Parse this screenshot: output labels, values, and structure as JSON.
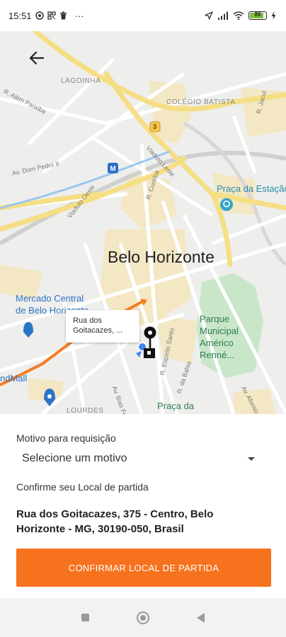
{
  "status_bar": {
    "time": "15:51",
    "more": "···",
    "battery_level": "86",
    "battery_color": "#7bc043"
  },
  "map": {
    "labels": {
      "lagoinha": "LAGOINHA",
      "colegio_batista": "COLÉGIO BATISTA",
      "alem_paraiba": "R. Além Paraíba",
      "jacui": "R. Jacuí",
      "dom_pedro": "Av. Dom Pedro II",
      "viaduto_oeste": "Viaduto Oeste",
      "viaduto_leste": "Viaduto Leste",
      "curitiba": "R. Curitiba",
      "praca_estacao": "Praça da Estação",
      "city": "Belo Horizonte",
      "mercado": "Mercado Central\nde Belo Horizonte",
      "parque": "Parque\nMunicipal\nAmérico\nRenné...",
      "espirito_santo": "R. Espírito Santo",
      "da_bahia": "R. da Bahia",
      "andmall": "ndMall",
      "bias_fortes": "Av. Bias Fortes",
      "praca_da": "Praça da",
      "lourdes": "LOURDES",
      "afonso": "Av. Afonso",
      "route_badge": "3"
    },
    "callout_text": "Rua dos Goitacazes, ...",
    "route_color": "#f57c22"
  },
  "form": {
    "reason_label": "Motivo para requisição",
    "reason_value": "Selecione um motivo",
    "confirm_label": "Confirme seu Local de partida",
    "address": "Rua dos Goitacazes, 375 - Centro, Belo Horizonte - MG, 30190-050, Brasil",
    "confirm_button": "CONFIRMAR LOCAL DE PARTIDA",
    "accent_color": "#f7721f"
  }
}
